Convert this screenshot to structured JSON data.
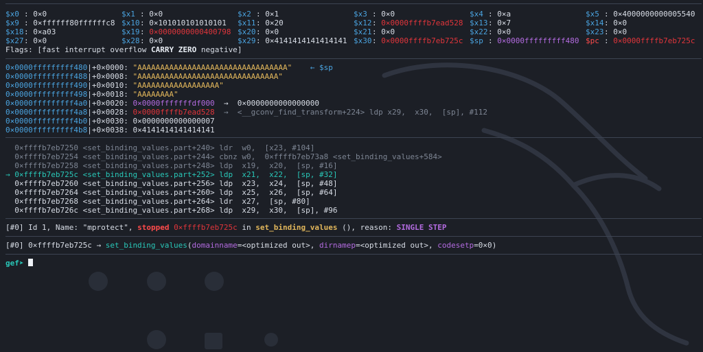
{
  "registers": [
    {
      "name": "$x0",
      "value": "0×0",
      "name_color": "#4aa3df",
      "value_color": "#d8dde6"
    },
    {
      "name": "$x1",
      "value": "0×0",
      "name_color": "#4aa3df",
      "value_color": "#d8dde6"
    },
    {
      "name": "$x2",
      "value": "0×1",
      "name_color": "#4aa3df",
      "value_color": "#d8dde6"
    },
    {
      "name": "$x3",
      "value": "0×0",
      "name_color": "#4aa3df",
      "value_color": "#d8dde6"
    },
    {
      "name": "$x4",
      "value": "0×a",
      "name_color": "#4aa3df",
      "value_color": "#d8dde6"
    },
    {
      "name": "$x5",
      "value": "0×4000000000005540",
      "name_color": "#4aa3df",
      "value_color": "#d8dde6"
    },
    {
      "name": "$x9",
      "value": "0×ffffff80ffffffc8",
      "name_color": "#4aa3df",
      "value_color": "#d8dde6"
    },
    {
      "name": "$x10",
      "value": "0×101010101010101",
      "name_color": "#4aa3df",
      "value_color": "#d8dde6"
    },
    {
      "name": "$x11",
      "value": "0×20",
      "name_color": "#4aa3df",
      "value_color": "#d8dde6"
    },
    {
      "name": "$x12",
      "value": "0×0000ffffb7ead528",
      "name_color": "#4aa3df",
      "value_color": "#e0353b"
    },
    {
      "name": "$x13",
      "value": "0×7",
      "name_color": "#4aa3df",
      "value_color": "#d8dde6"
    },
    {
      "name": "$x14",
      "value": "0×0",
      "name_color": "#4aa3df",
      "value_color": "#d8dde6"
    },
    {
      "name": "$x18",
      "value": "0×a03",
      "name_color": "#4aa3df",
      "value_color": "#d8dde6"
    },
    {
      "name": "$x19",
      "value": "0×0000000000400798",
      "name_color": "#4aa3df",
      "value_color": "#e0353b"
    },
    {
      "name": "$x20",
      "value": "0×0",
      "name_color": "#4aa3df",
      "value_color": "#d8dde6"
    },
    {
      "name": "$x21",
      "value": "0×0",
      "name_color": "#4aa3df",
      "value_color": "#d8dde6"
    },
    {
      "name": "$x22",
      "value": "0×0",
      "name_color": "#4aa3df",
      "value_color": "#d8dde6"
    },
    {
      "name": "$x23",
      "value": "0×0",
      "name_color": "#4aa3df",
      "value_color": "#d8dde6"
    },
    {
      "name": "$x27",
      "value": "0×0",
      "name_color": "#4aa3df",
      "value_color": "#d8dde6"
    },
    {
      "name": "$x28",
      "value": "0×0",
      "name_color": "#4aa3df",
      "value_color": "#d8dde6"
    },
    {
      "name": "$x29",
      "value": "0×4141414141414141",
      "name_color": "#4aa3df",
      "value_color": "#d8dde6"
    },
    {
      "name": "$x30",
      "value": "0×0000ffffb7eb725c",
      "name_color": "#4aa3df",
      "value_color": "#e0353b"
    },
    {
      "name": "$sp",
      "value": "0×0000fffffffff480",
      "name_color": "#4aa3df",
      "value_color": "#b36be0"
    },
    {
      "name": "$pc",
      "value": "0×0000ffffb7eb725c",
      "name_color": "#ff4b4b",
      "value_color": "#e0353b"
    }
  ],
  "flags": {
    "prefix": "Flags: [",
    "fast": "fast",
    "interrupt": "interrupt",
    "overflow": "overflow",
    "carry": "CARRY",
    "zero": "ZERO",
    "negative": "negative",
    "suffix": "]"
  },
  "stack": [
    {
      "addr": "0×0000fffffffff480",
      "off": "+0×0000: ",
      "val": "\"AAAAAAAAAAAAAAAAAAAAAAAAAAAAAAAAA\"",
      "val_color": "#e1b65b",
      "tail": "    ← $sp",
      "tail_color": "#4aa3df"
    },
    {
      "addr": "0×0000fffffffff488",
      "off": "+0×0008: ",
      "val": "\"AAAAAAAAAAAAAAAAAAAAAAAAAAAAAAA\"",
      "val_color": "#e1b65b",
      "tail": "",
      "tail_color": "#d8dde6"
    },
    {
      "addr": "0×0000fffffffff490",
      "off": "+0×0010: ",
      "val": "\"AAAAAAAAAAAAAAAAAA\"",
      "val_color": "#e1b65b",
      "tail": "",
      "tail_color": "#d8dde6"
    },
    {
      "addr": "0×0000fffffffff498",
      "off": "+0×0018: ",
      "val": "\"AAAAAAAA\"",
      "val_color": "#e1b65b",
      "tail": "",
      "tail_color": "#d8dde6"
    },
    {
      "addr": "0×0000fffffffff4a0",
      "off": "+0×0020: ",
      "val": "0×0000fffffffdf000",
      "val_color": "#b36be0",
      "tail": "  →  0×0000000000000000",
      "tail_color": "#d8dde6"
    },
    {
      "addr": "0×0000fffffffff4a8",
      "off": "+0×0028: ",
      "val": "0×0000ffffb7ead528",
      "val_color": "#e0353b",
      "tail": "  →  <__gconv_find_transform+224> ldp x29,  x30,  [sp], #112",
      "tail_color": "#7d8593"
    },
    {
      "addr": "0×0000fffffffff4b0",
      "off": "+0×0030: ",
      "val": "0×0000000000000007",
      "val_color": "#d8dde6",
      "tail": "",
      "tail_color": "#d8dde6"
    },
    {
      "addr": "0×0000fffffffff4b8",
      "off": "+0×0038: ",
      "val": "0×4141414141414141",
      "val_color": "#d8dde6",
      "tail": "",
      "tail_color": "#d8dde6"
    }
  ],
  "code": [
    {
      "marker": "  ",
      "addr": "0×ffffb7eb7250",
      "sym": "<set_binding_values.part+240>",
      "mn": "ldr",
      "ops": "  w0,  [x23, #104]",
      "color": "#7d8593"
    },
    {
      "marker": "  ",
      "addr": "0×ffffb7eb7254",
      "sym": "<set_binding_values.part+244>",
      "mn": "cbnz",
      "ops": " w0,  0×ffffb7eb73a8 <set_binding_values+584>",
      "color": "#7d8593"
    },
    {
      "marker": "  ",
      "addr": "0×ffffb7eb7258",
      "sym": "<set_binding_values.part+248>",
      "mn": "ldp",
      "ops": "  x19,  x20,  [sp, #16]",
      "color": "#7d8593"
    },
    {
      "marker": "→ ",
      "addr": "0×ffffb7eb725c",
      "sym": "<set_binding_values.part+252>",
      "mn": "ldp",
      "ops": "  x21,  x22,  [sp, #32]",
      "color": "#29c7b8"
    },
    {
      "marker": "  ",
      "addr": "0×ffffb7eb7260",
      "sym": "<set_binding_values.part+256>",
      "mn": "ldp",
      "ops": "  x23,  x24,  [sp, #48]",
      "color": "#d8dde6"
    },
    {
      "marker": "  ",
      "addr": "0×ffffb7eb7264",
      "sym": "<set_binding_values.part+260>",
      "mn": "ldp",
      "ops": "  x25,  x26,  [sp, #64]",
      "color": "#d8dde6"
    },
    {
      "marker": "  ",
      "addr": "0×ffffb7eb7268",
      "sym": "<set_binding_values.part+264>",
      "mn": "ldr",
      "ops": "  x27,  [sp, #80]",
      "color": "#d8dde6"
    },
    {
      "marker": "  ",
      "addr": "0×ffffb7eb726c",
      "sym": "<set_binding_values.part+268>",
      "mn": "ldp",
      "ops": "  x29,  x30,  [sp], #96",
      "color": "#d8dde6"
    }
  ],
  "thread": {
    "prefix": "[#0] Id 1, Name: ",
    "name": "\"mprotect\"",
    "sep": ", ",
    "status": "stopped",
    "addr": "0×ffffb7eb725c",
    "in": " in ",
    "func": "set_binding_values",
    "mid": " (), reason: ",
    "reason": "SINGLE STEP"
  },
  "trace": {
    "prefix": "[#0] 0×ffffb7eb725c → ",
    "func": "set_binding_values",
    "open": "(",
    "a1n": "domainname",
    "a1v": "=<optimized out>, ",
    "a2n": "dirnamep",
    "a2v": "=<optimized out>, ",
    "a3n": "codesetp",
    "a3v": "=0×0",
    "close": ")"
  },
  "prompt": {
    "text": "gef➤"
  }
}
